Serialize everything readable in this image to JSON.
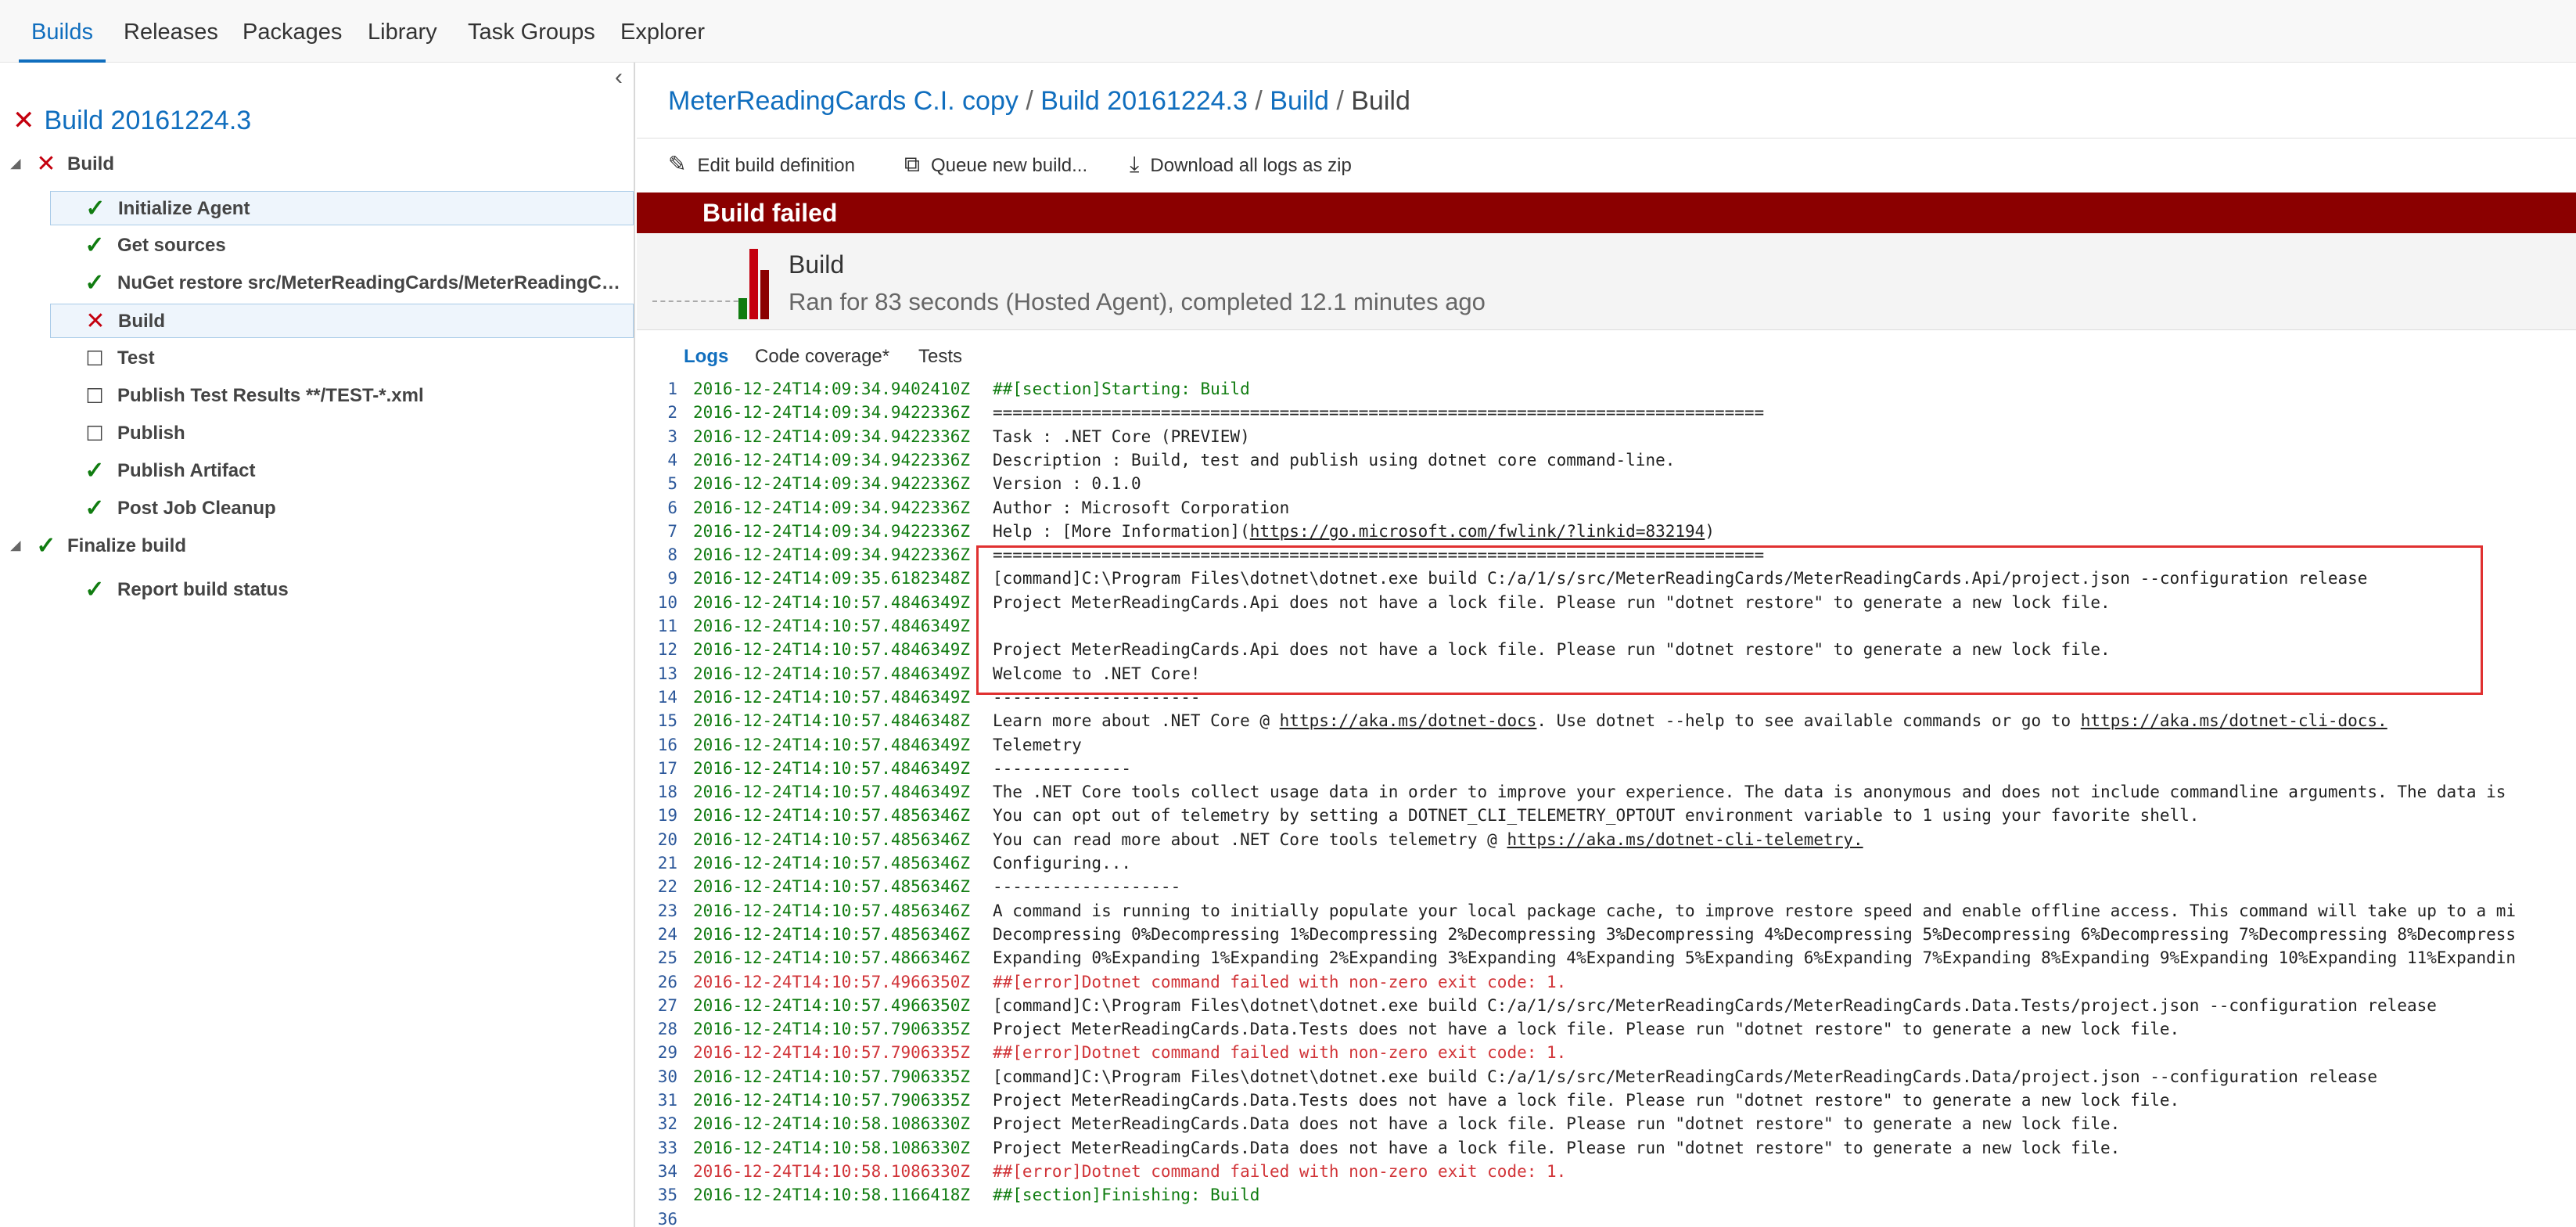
{
  "colors": {
    "accent": "#106ebe",
    "success": "#107c10",
    "error": "#c4000e",
    "banner": "#8b0000",
    "log_error": "#d13438",
    "highlight": "#e03030"
  },
  "nav": {
    "tabs": [
      {
        "label": "Builds",
        "active": true
      },
      {
        "label": "Releases"
      },
      {
        "label": "Packages"
      },
      {
        "label": "Library"
      },
      {
        "label": "Task Groups"
      },
      {
        "label": "Explorer"
      }
    ]
  },
  "sidebar": {
    "collapse_icon": "chevron-left-icon",
    "build_title": "Build 20161224.3",
    "build_status": "failed",
    "phases": [
      {
        "label": "Build",
        "status": "failed",
        "steps": [
          {
            "label": "Initialize Agent",
            "status": "succeeded",
            "selected": true
          },
          {
            "label": "Get sources",
            "status": "succeeded"
          },
          {
            "label": "NuGet restore src/MeterReadingCards/MeterReadingCar...",
            "status": "succeeded"
          },
          {
            "label": "Build",
            "status": "failed",
            "selected": true
          },
          {
            "label": "Test",
            "status": "not-run"
          },
          {
            "label": "Publish Test Results **/TEST-*.xml",
            "status": "not-run"
          },
          {
            "label": "Publish",
            "status": "not-run"
          },
          {
            "label": "Publish Artifact",
            "status": "succeeded"
          },
          {
            "label": "Post Job Cleanup",
            "status": "succeeded"
          }
        ]
      },
      {
        "label": "Finalize build",
        "status": "succeeded",
        "steps": [
          {
            "label": "Report build status",
            "status": "succeeded"
          }
        ]
      }
    ]
  },
  "breadcrumb": {
    "items": [
      "MeterReadingCards C.I. copy",
      "Build 20161224.3",
      "Build"
    ],
    "current": "Build",
    "separator": "/"
  },
  "toolbar": {
    "edit_label": "Edit build definition",
    "edit_icon": "pencil-icon",
    "queue_label": "Queue new build...",
    "queue_icon": "queue-icon",
    "download_label": "Download all logs as zip",
    "download_icon": "download-icon"
  },
  "banner": {
    "text": "Build failed"
  },
  "summary": {
    "title": "Build",
    "subtitle": "Ran for 83 seconds (Hosted Agent), completed 12.1 minutes ago",
    "history_bars": [
      {
        "level": 0.3,
        "color": "#107c10"
      },
      {
        "level": 1.0,
        "color": "#c4000e"
      },
      {
        "level": 0.7,
        "color": "#8b0000"
      }
    ]
  },
  "log_tabs": [
    {
      "label": "Logs",
      "active": true
    },
    {
      "label": "Code coverage*"
    },
    {
      "label": "Tests"
    }
  ],
  "log_lines": [
    {
      "n": "1",
      "ts": "2016-12-24T14:09:34.9402410Z",
      "msg": "##[section]Starting: Build",
      "type": "section"
    },
    {
      "n": "2",
      "ts": "2016-12-24T14:09:34.9422336Z",
      "msg": "=============================================================================="
    },
    {
      "n": "3",
      "ts": "2016-12-24T14:09:34.9422336Z",
      "msg": "Task         : .NET Core (PREVIEW)"
    },
    {
      "n": "4",
      "ts": "2016-12-24T14:09:34.9422336Z",
      "msg": "Description  : Build, test and publish using dotnet core command-line."
    },
    {
      "n": "5",
      "ts": "2016-12-24T14:09:34.9422336Z",
      "msg": "Version      : 0.1.0"
    },
    {
      "n": "6",
      "ts": "2016-12-24T14:09:34.9422336Z",
      "msg": "Author       : Microsoft Corporation"
    },
    {
      "n": "7",
      "ts": "2016-12-24T14:09:34.9422336Z",
      "msg": "Help         : [More Information](",
      "link": "https://go.microsoft.com/fwlink/?linkid=832194",
      "after": ")"
    },
    {
      "n": "8",
      "ts": "2016-12-24T14:09:34.9422336Z",
      "msg": "=============================================================================="
    },
    {
      "n": "9",
      "ts": "2016-12-24T14:09:35.6182348Z",
      "msg": "[command]C:\\Program Files\\dotnet\\dotnet.exe build C:/a/1/s/src/MeterReadingCards/MeterReadingCards.Api/project.json --configuration release"
    },
    {
      "n": "10",
      "ts": "2016-12-24T14:10:57.4846349Z",
      "msg": "Project MeterReadingCards.Api does not have a lock file. Please run \"dotnet restore\" to generate a new lock file."
    },
    {
      "n": "11",
      "ts": "2016-12-24T14:10:57.4846349Z",
      "msg": ""
    },
    {
      "n": "12",
      "ts": "2016-12-24T14:10:57.4846349Z",
      "msg": "Project MeterReadingCards.Api does not have a lock file. Please run \"dotnet restore\" to generate a new lock file."
    },
    {
      "n": "13",
      "ts": "2016-12-24T14:10:57.4846349Z",
      "msg": "Welcome to .NET Core!"
    },
    {
      "n": "14",
      "ts": "2016-12-24T14:10:57.4846349Z",
      "msg": "---------------------"
    },
    {
      "n": "15",
      "ts": "2016-12-24T14:10:57.4846348Z",
      "msg": "Learn more about .NET Core @ ",
      "link": "https://aka.ms/dotnet-docs",
      "after": ". Use dotnet --help to see available commands or go to ",
      "link2": "https://aka.ms/dotnet-cli-docs."
    },
    {
      "n": "16",
      "ts": "2016-12-24T14:10:57.4846349Z",
      "msg": "Telemetry"
    },
    {
      "n": "17",
      "ts": "2016-12-24T14:10:57.4846349Z",
      "msg": "--------------"
    },
    {
      "n": "18",
      "ts": "2016-12-24T14:10:57.4846349Z",
      "msg": "The .NET Core tools collect usage data in order to improve your experience. The data is anonymous and does not include commandline arguments. The data is"
    },
    {
      "n": "19",
      "ts": "2016-12-24T14:10:57.4856346Z",
      "msg": "You can opt out of telemetry by setting a DOTNET_CLI_TELEMETRY_OPTOUT environment variable to 1 using your favorite shell."
    },
    {
      "n": "20",
      "ts": "2016-12-24T14:10:57.4856346Z",
      "msg": "You can read more about .NET Core tools telemetry @ ",
      "link": "https://aka.ms/dotnet-cli-telemetry."
    },
    {
      "n": "21",
      "ts": "2016-12-24T14:10:57.4856346Z",
      "msg": "Configuring..."
    },
    {
      "n": "22",
      "ts": "2016-12-24T14:10:57.4856346Z",
      "msg": "-------------------"
    },
    {
      "n": "23",
      "ts": "2016-12-24T14:10:57.4856346Z",
      "msg": "A command is running to initially populate your local package cache, to improve restore speed and enable offline access. This command will take up to a mi"
    },
    {
      "n": "24",
      "ts": "2016-12-24T14:10:57.4856346Z",
      "msg": "Decompressing 0%Decompressing 1%Decompressing 2%Decompressing 3%Decompressing 4%Decompressing 5%Decompressing 6%Decompressing 7%Decompressing 8%Decompress"
    },
    {
      "n": "25",
      "ts": "2016-12-24T14:10:57.4866346Z",
      "msg": "Expanding 0%Expanding 1%Expanding 2%Expanding 3%Expanding 4%Expanding 5%Expanding 6%Expanding 7%Expanding 8%Expanding 9%Expanding 10%Expanding 11%Expandin"
    },
    {
      "n": "26",
      "ts": "2016-12-24T14:10:57.4966350Z",
      "msg": "##[error]Dotnet command failed with non-zero exit code: 1.",
      "type": "error"
    },
    {
      "n": "27",
      "ts": "2016-12-24T14:10:57.4966350Z",
      "msg": "[command]C:\\Program Files\\dotnet\\dotnet.exe build C:/a/1/s/src/MeterReadingCards/MeterReadingCards.Data.Tests/project.json --configuration release"
    },
    {
      "n": "28",
      "ts": "2016-12-24T14:10:57.7906335Z",
      "msg": "Project MeterReadingCards.Data.Tests does not have a lock file. Please run \"dotnet restore\" to generate a new lock file."
    },
    {
      "n": "29",
      "ts": "2016-12-24T14:10:57.7906335Z",
      "msg": "##[error]Dotnet command failed with non-zero exit code: 1.",
      "type": "error"
    },
    {
      "n": "30",
      "ts": "2016-12-24T14:10:57.7906335Z",
      "msg": "[command]C:\\Program Files\\dotnet\\dotnet.exe build C:/a/1/s/src/MeterReadingCards/MeterReadingCards.Data/project.json --configuration release"
    },
    {
      "n": "31",
      "ts": "2016-12-24T14:10:57.7906335Z",
      "msg": "Project MeterReadingCards.Data.Tests does not have a lock file. Please run \"dotnet restore\" to generate a new lock file."
    },
    {
      "n": "32",
      "ts": "2016-12-24T14:10:58.1086330Z",
      "msg": "Project MeterReadingCards.Data does not have a lock file. Please run \"dotnet restore\" to generate a new lock file."
    },
    {
      "n": "33",
      "ts": "2016-12-24T14:10:58.1086330Z",
      "msg": "Project MeterReadingCards.Data does not have a lock file. Please run \"dotnet restore\" to generate a new lock file."
    },
    {
      "n": "34",
      "ts": "2016-12-24T14:10:58.1086330Z",
      "msg": "##[error]Dotnet command failed with non-zero exit code: 1.",
      "type": "error"
    },
    {
      "n": "35",
      "ts": "2016-12-24T14:10:58.1166418Z",
      "msg": "##[section]Finishing: Build",
      "type": "section"
    },
    {
      "n": "36",
      "ts": "",
      "msg": ""
    }
  ]
}
